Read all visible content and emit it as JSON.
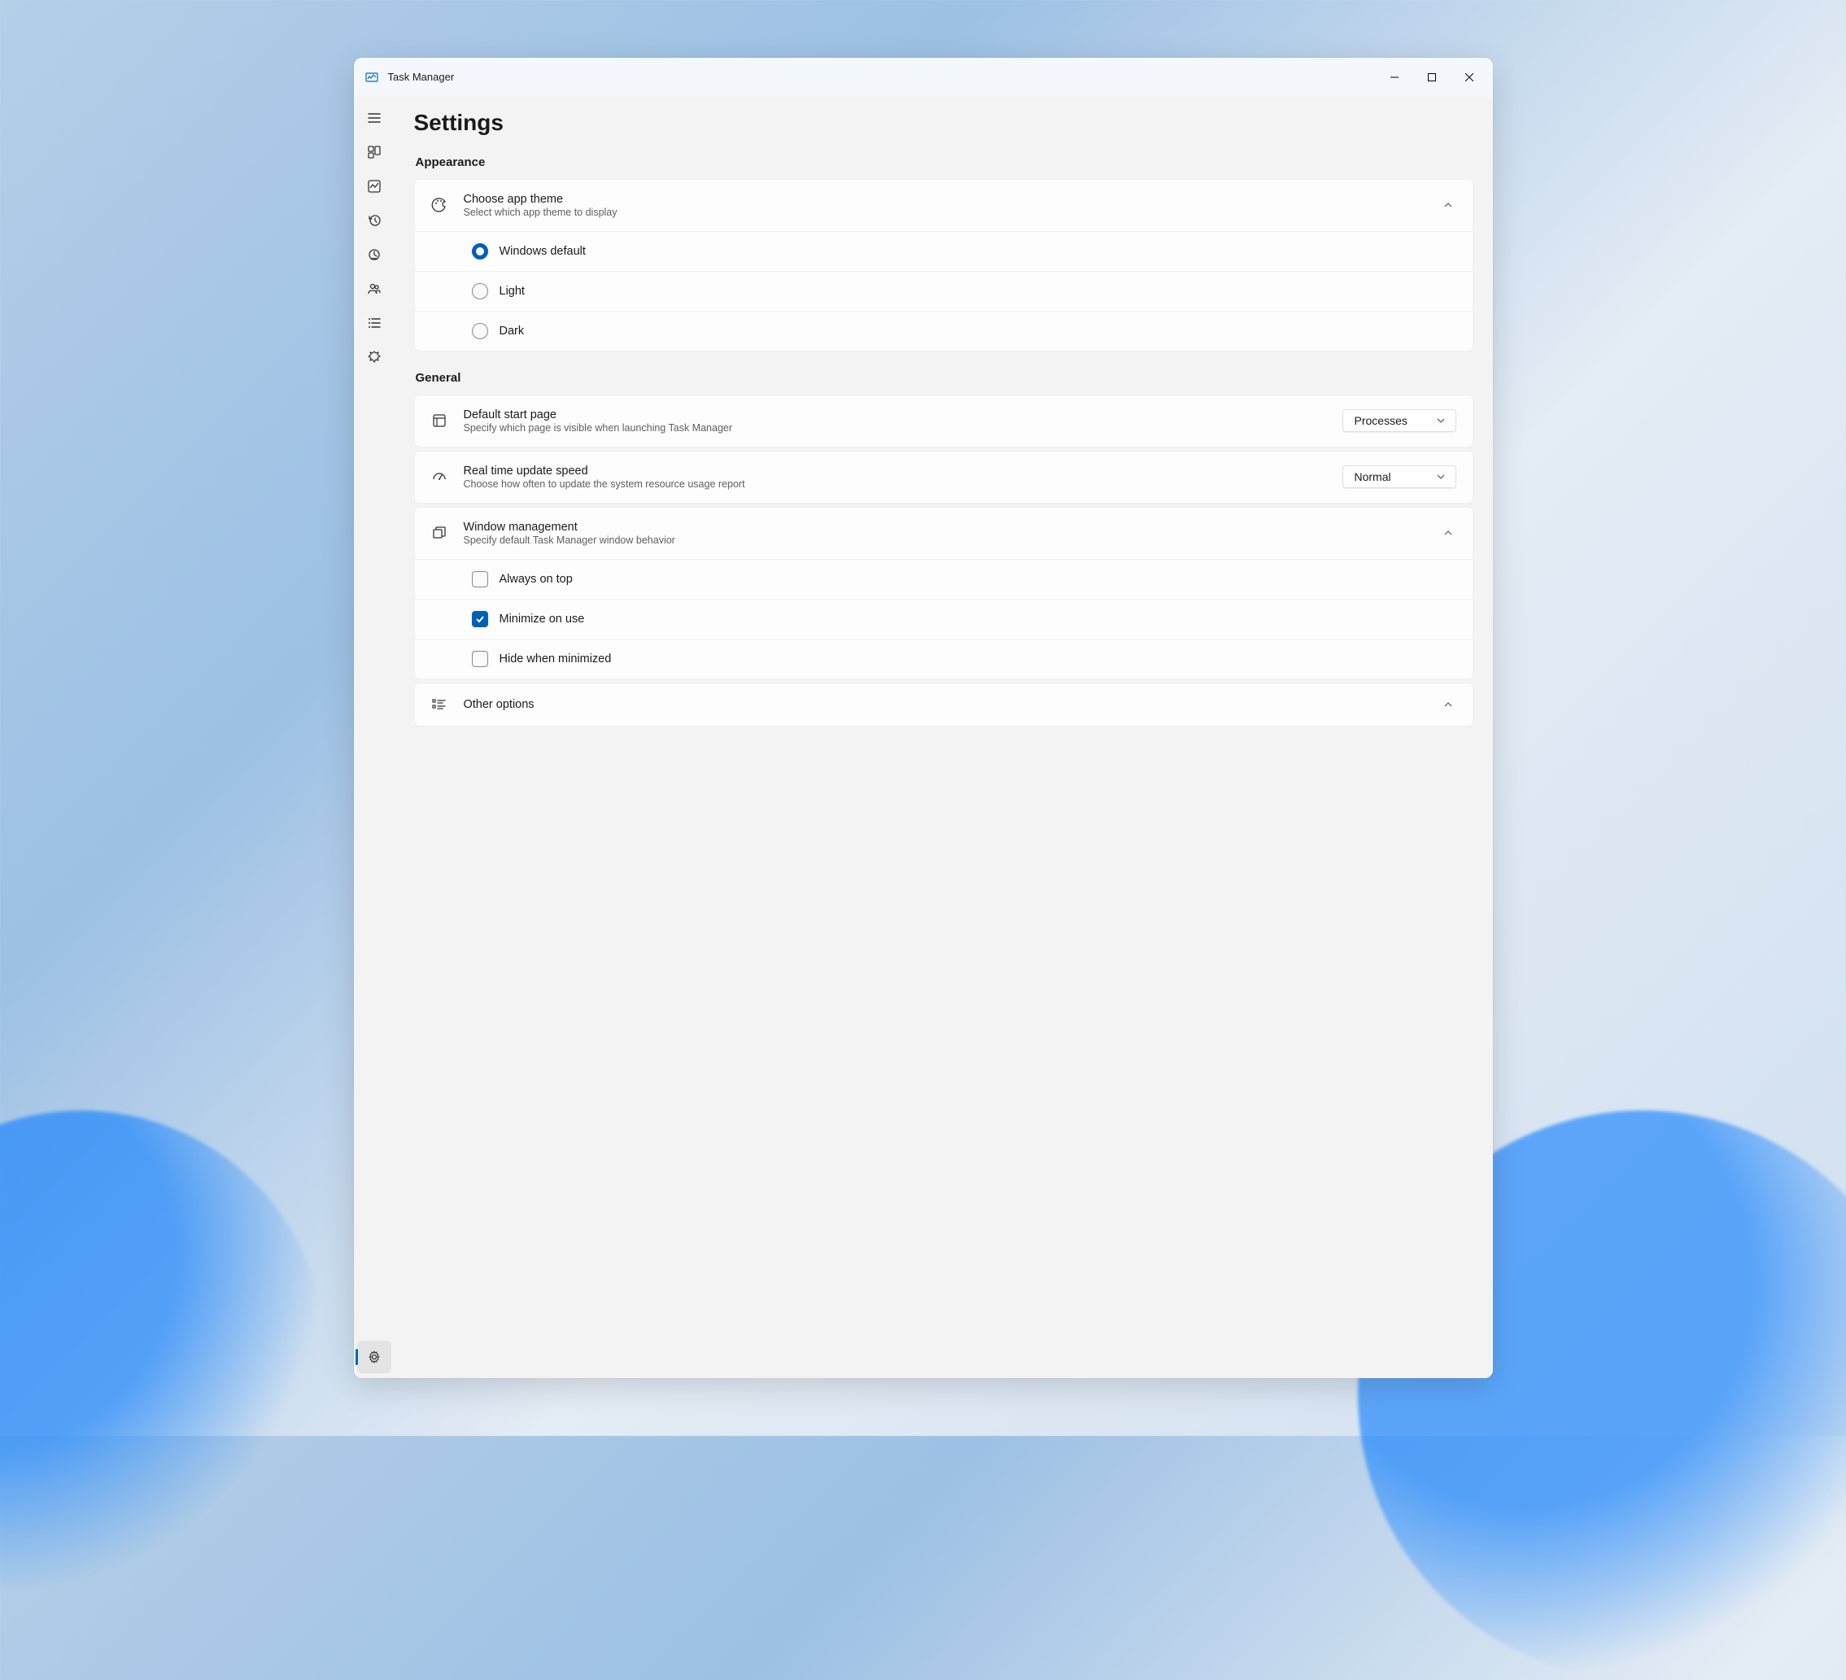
{
  "app": {
    "title": "Task Manager"
  },
  "page": {
    "title": "Settings"
  },
  "sections": {
    "appearance": {
      "label": "Appearance",
      "theme": {
        "title": "Choose app theme",
        "subtitle": "Select which app theme to display",
        "options": {
          "default": "Windows default",
          "light": "Light",
          "dark": "Dark"
        },
        "selected": "default"
      }
    },
    "general": {
      "label": "General",
      "startPage": {
        "title": "Default start page",
        "subtitle": "Specify which page is visible when launching Task Manager",
        "value": "Processes"
      },
      "updateSpeed": {
        "title": "Real time update speed",
        "subtitle": "Choose how often to update the system resource usage report",
        "value": "Normal"
      },
      "windowMgmt": {
        "title": "Window management",
        "subtitle": "Specify default Task Manager window behavior",
        "options": {
          "alwaysOnTop": {
            "label": "Always on top",
            "checked": false
          },
          "minimizeOnUse": {
            "label": "Minimize on use",
            "checked": true
          },
          "hideWhenMinimized": {
            "label": "Hide when minimized",
            "checked": false
          }
        }
      },
      "other": {
        "title": "Other options"
      }
    }
  },
  "nav": {
    "items": [
      "menu",
      "processes",
      "performance",
      "history",
      "startup",
      "users",
      "details",
      "services"
    ],
    "settings": "settings"
  }
}
